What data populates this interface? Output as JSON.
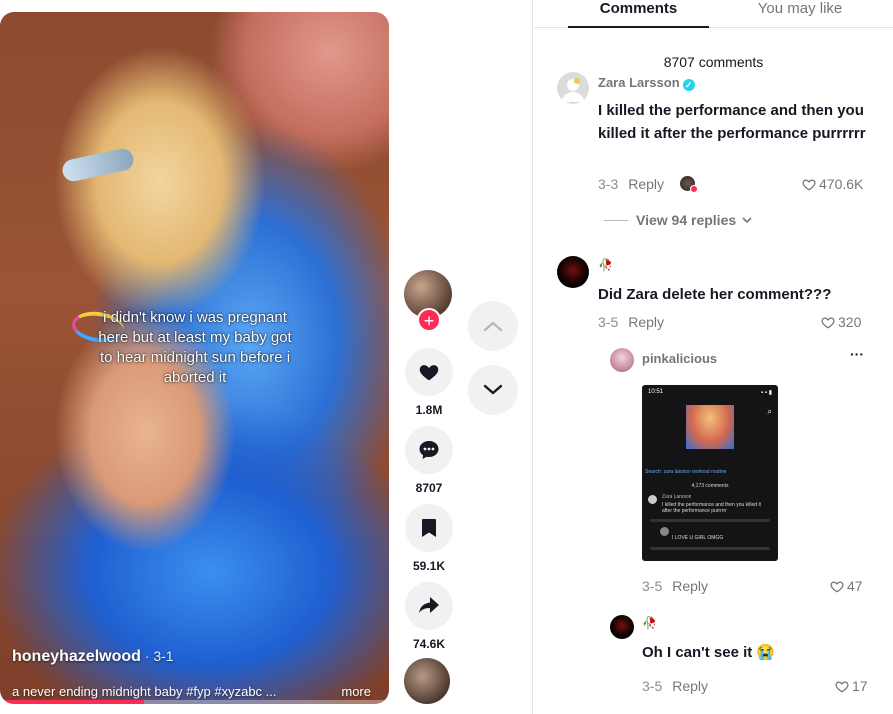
{
  "video": {
    "overlay_caption": "i didn't know i was pregnant here but at least my baby got to hear midnight sun before i aborted it",
    "author": "honeyhazelwood",
    "date": " · 3-1",
    "description": "a never ending midnight baby #fyp #xyzabc ...",
    "more_label": "more",
    "progress_fraction": 0.37
  },
  "actions": {
    "likes": "1.8M",
    "comments": "8707",
    "saves": "59.1K",
    "shares": "74.6K"
  },
  "tabs": [
    "Comments",
    "You may like"
  ],
  "comments_count_label": "8707 comments",
  "comments": [
    {
      "user": "Zara Larsson",
      "verified": true,
      "text": "I killed the performance and then you killed it after the performance purrrrrr",
      "date": "3-3",
      "reply_label": "Reply",
      "likes": "470.6K",
      "view_replies": "View 94 replies"
    },
    {
      "user_emoji": "🥀",
      "text": "Did Zara delete her comment???",
      "date": "3-5",
      "reply_label": "Reply",
      "likes": "320"
    }
  ],
  "replies": [
    {
      "user": "pinkalicious",
      "more_icon": "···",
      "date": "3-5",
      "reply_label": "Reply",
      "likes": "47"
    },
    {
      "user_emoji": "🥀",
      "text": "Oh I can't see it 😭",
      "date": "3-5",
      "reply_label": "Reply",
      "likes": "17"
    }
  ],
  "screenshot": {
    "time": "10:51",
    "search": "Search: zara larsson workout routine",
    "count": "4,173 comments",
    "c1_name": "Zara Larsson",
    "c1_text": "I killed the performance and then you killed it after the performance purrrrrr",
    "c2_text": "I LOVE U GIRL OMGG"
  },
  "colors": {
    "accent": "#fe2c55",
    "verified": "#20d5ec",
    "muted_text": "rgba(22,24,35,0.6)"
  }
}
